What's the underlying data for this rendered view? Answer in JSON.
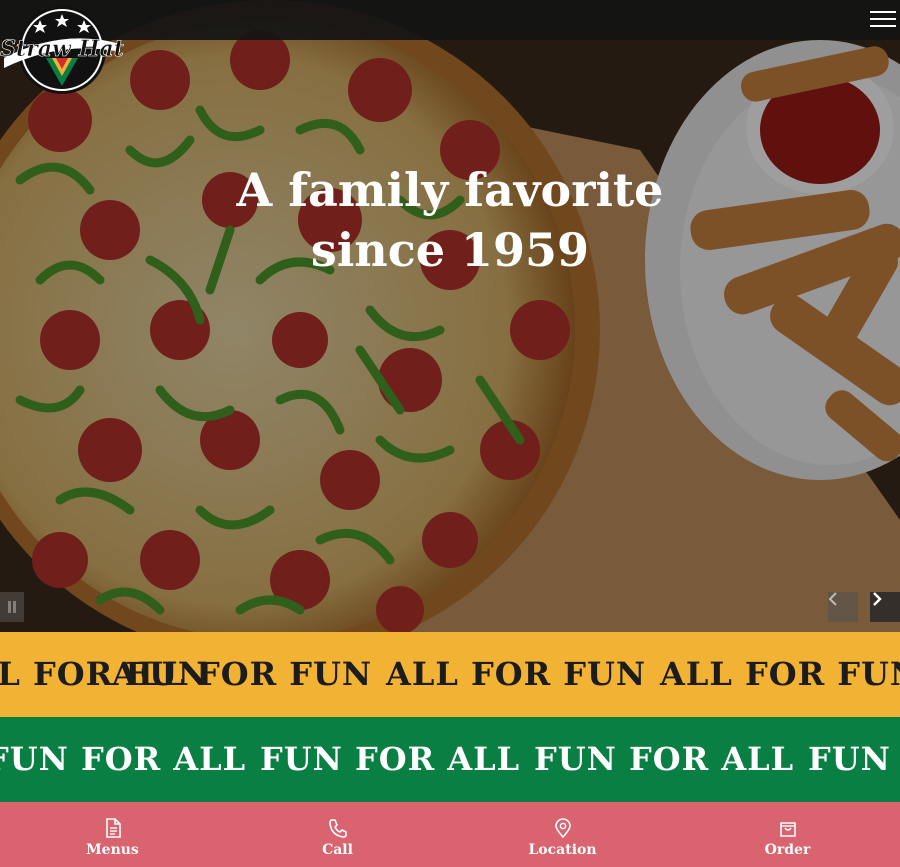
{
  "brand": {
    "logo_text": "Straw Hat"
  },
  "hero": {
    "title_line1": "A family favorite",
    "title_line2": "since 1959"
  },
  "marquee": {
    "yellow_text": "ALL FOR FUN",
    "green_text": "FUN FOR ALL"
  },
  "nav": {
    "items": [
      {
        "label": "Menus",
        "icon": "document-icon"
      },
      {
        "label": "Call",
        "icon": "phone-icon"
      },
      {
        "label": "Location",
        "icon": "map-pin-icon"
      },
      {
        "label": "Order",
        "icon": "shopping-bag-icon"
      }
    ]
  },
  "colors": {
    "yellow_band": "#f2b233",
    "green_band": "#0a7f43",
    "bottom_nav": "#d9636e",
    "topbar": "#141414"
  }
}
